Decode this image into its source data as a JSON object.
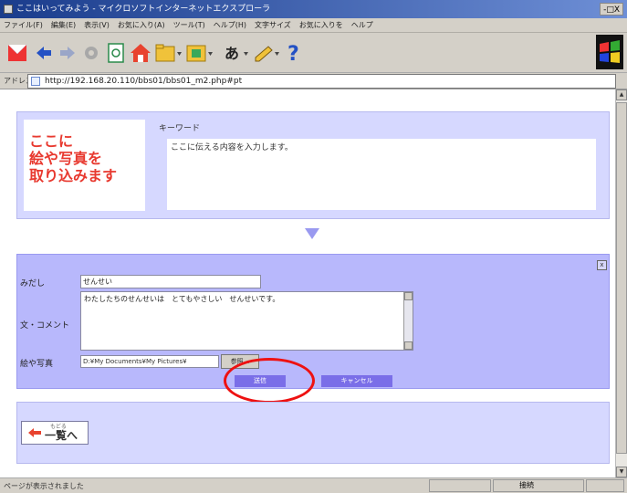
{
  "window": {
    "title": "ここはいってみよう - マイクロソフトインターネットエクスプローラ",
    "controls": "-□X"
  },
  "menu": [
    "ファイル(F)",
    "編集(E)",
    "表示(V)",
    "お気に入り(A)",
    "ツール(T)",
    "ヘルプ(H)",
    "文字サイズ",
    "お気に入りを",
    "ヘルプ"
  ],
  "address": {
    "label": "アドレス",
    "url": "http://192.168.20.110/bbs01/bbs01_m2.php#pt"
  },
  "preview": {
    "image_placeholder_lines": [
      "ここに",
      "絵や写真を",
      "取り込みます"
    ],
    "keyword_title": "キーワード",
    "content_text": "ここに伝える内容を入力します。"
  },
  "form": {
    "heading_label": "みだし",
    "heading_value": "せんせい",
    "comment_label": "文・コメント",
    "comment_value": "わたしたちのせんせいは　とてもやさしい　せんせいです。",
    "image_label": "絵や写真",
    "file_value": "D:¥My Documents¥My Pictures¥",
    "browse_label": "参照...",
    "submit_label": "送信",
    "cancel_label": "キャンセル",
    "close_label": "x"
  },
  "back_button": {
    "small_label": "もどる",
    "label": "一覧へ"
  },
  "status": {
    "text": "ページが表示されました",
    "zone": "接続"
  },
  "colors": {
    "preview_bg": "#d6d8ff",
    "form_bg": "#b8b8fc",
    "placeholder_text": "#e8392f",
    "highlight": "#e11111"
  }
}
